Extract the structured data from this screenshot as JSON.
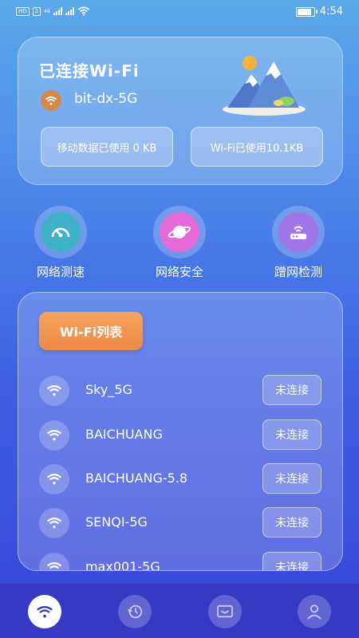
{
  "status_bar": {
    "left_badges": [
      "HD",
      "2"
    ],
    "network_label": "46",
    "time": "4:54",
    "battery_level": 0.8
  },
  "connected": {
    "title": "已连接Wi-Fi",
    "ssid": "bit-dx-5G",
    "mobile_data_usage": "移动数据已使用 0 KB",
    "wifi_usage": "Wi-Fi已使用10.1KB"
  },
  "features": [
    {
      "label": "网络测速",
      "icon": "speedometer-icon"
    },
    {
      "label": "网络安全",
      "icon": "planet-icon"
    },
    {
      "label": "蹭网检测",
      "icon": "router-icon"
    }
  ],
  "wifi_list": {
    "header": "Wi-Fi列表",
    "items": [
      {
        "name": "Sky_5G",
        "action": "未连接"
      },
      {
        "name": "BAICHUANG",
        "action": "未连接"
      },
      {
        "name": "BAICHUANG-5.8",
        "action": "未连接"
      },
      {
        "name": "SENQI-5G",
        "action": "未连接"
      },
      {
        "name": "max001-5G",
        "action": "未连接"
      }
    ]
  },
  "tab_bar": {
    "tabs": [
      {
        "icon": "wifi-icon",
        "active": true
      },
      {
        "icon": "history-icon",
        "active": false
      },
      {
        "icon": "message-icon",
        "active": false
      },
      {
        "icon": "profile-icon",
        "active": false
      }
    ]
  },
  "colors": {
    "accent_orange": "#ee8a45",
    "tab_bar": "#3539c4"
  }
}
